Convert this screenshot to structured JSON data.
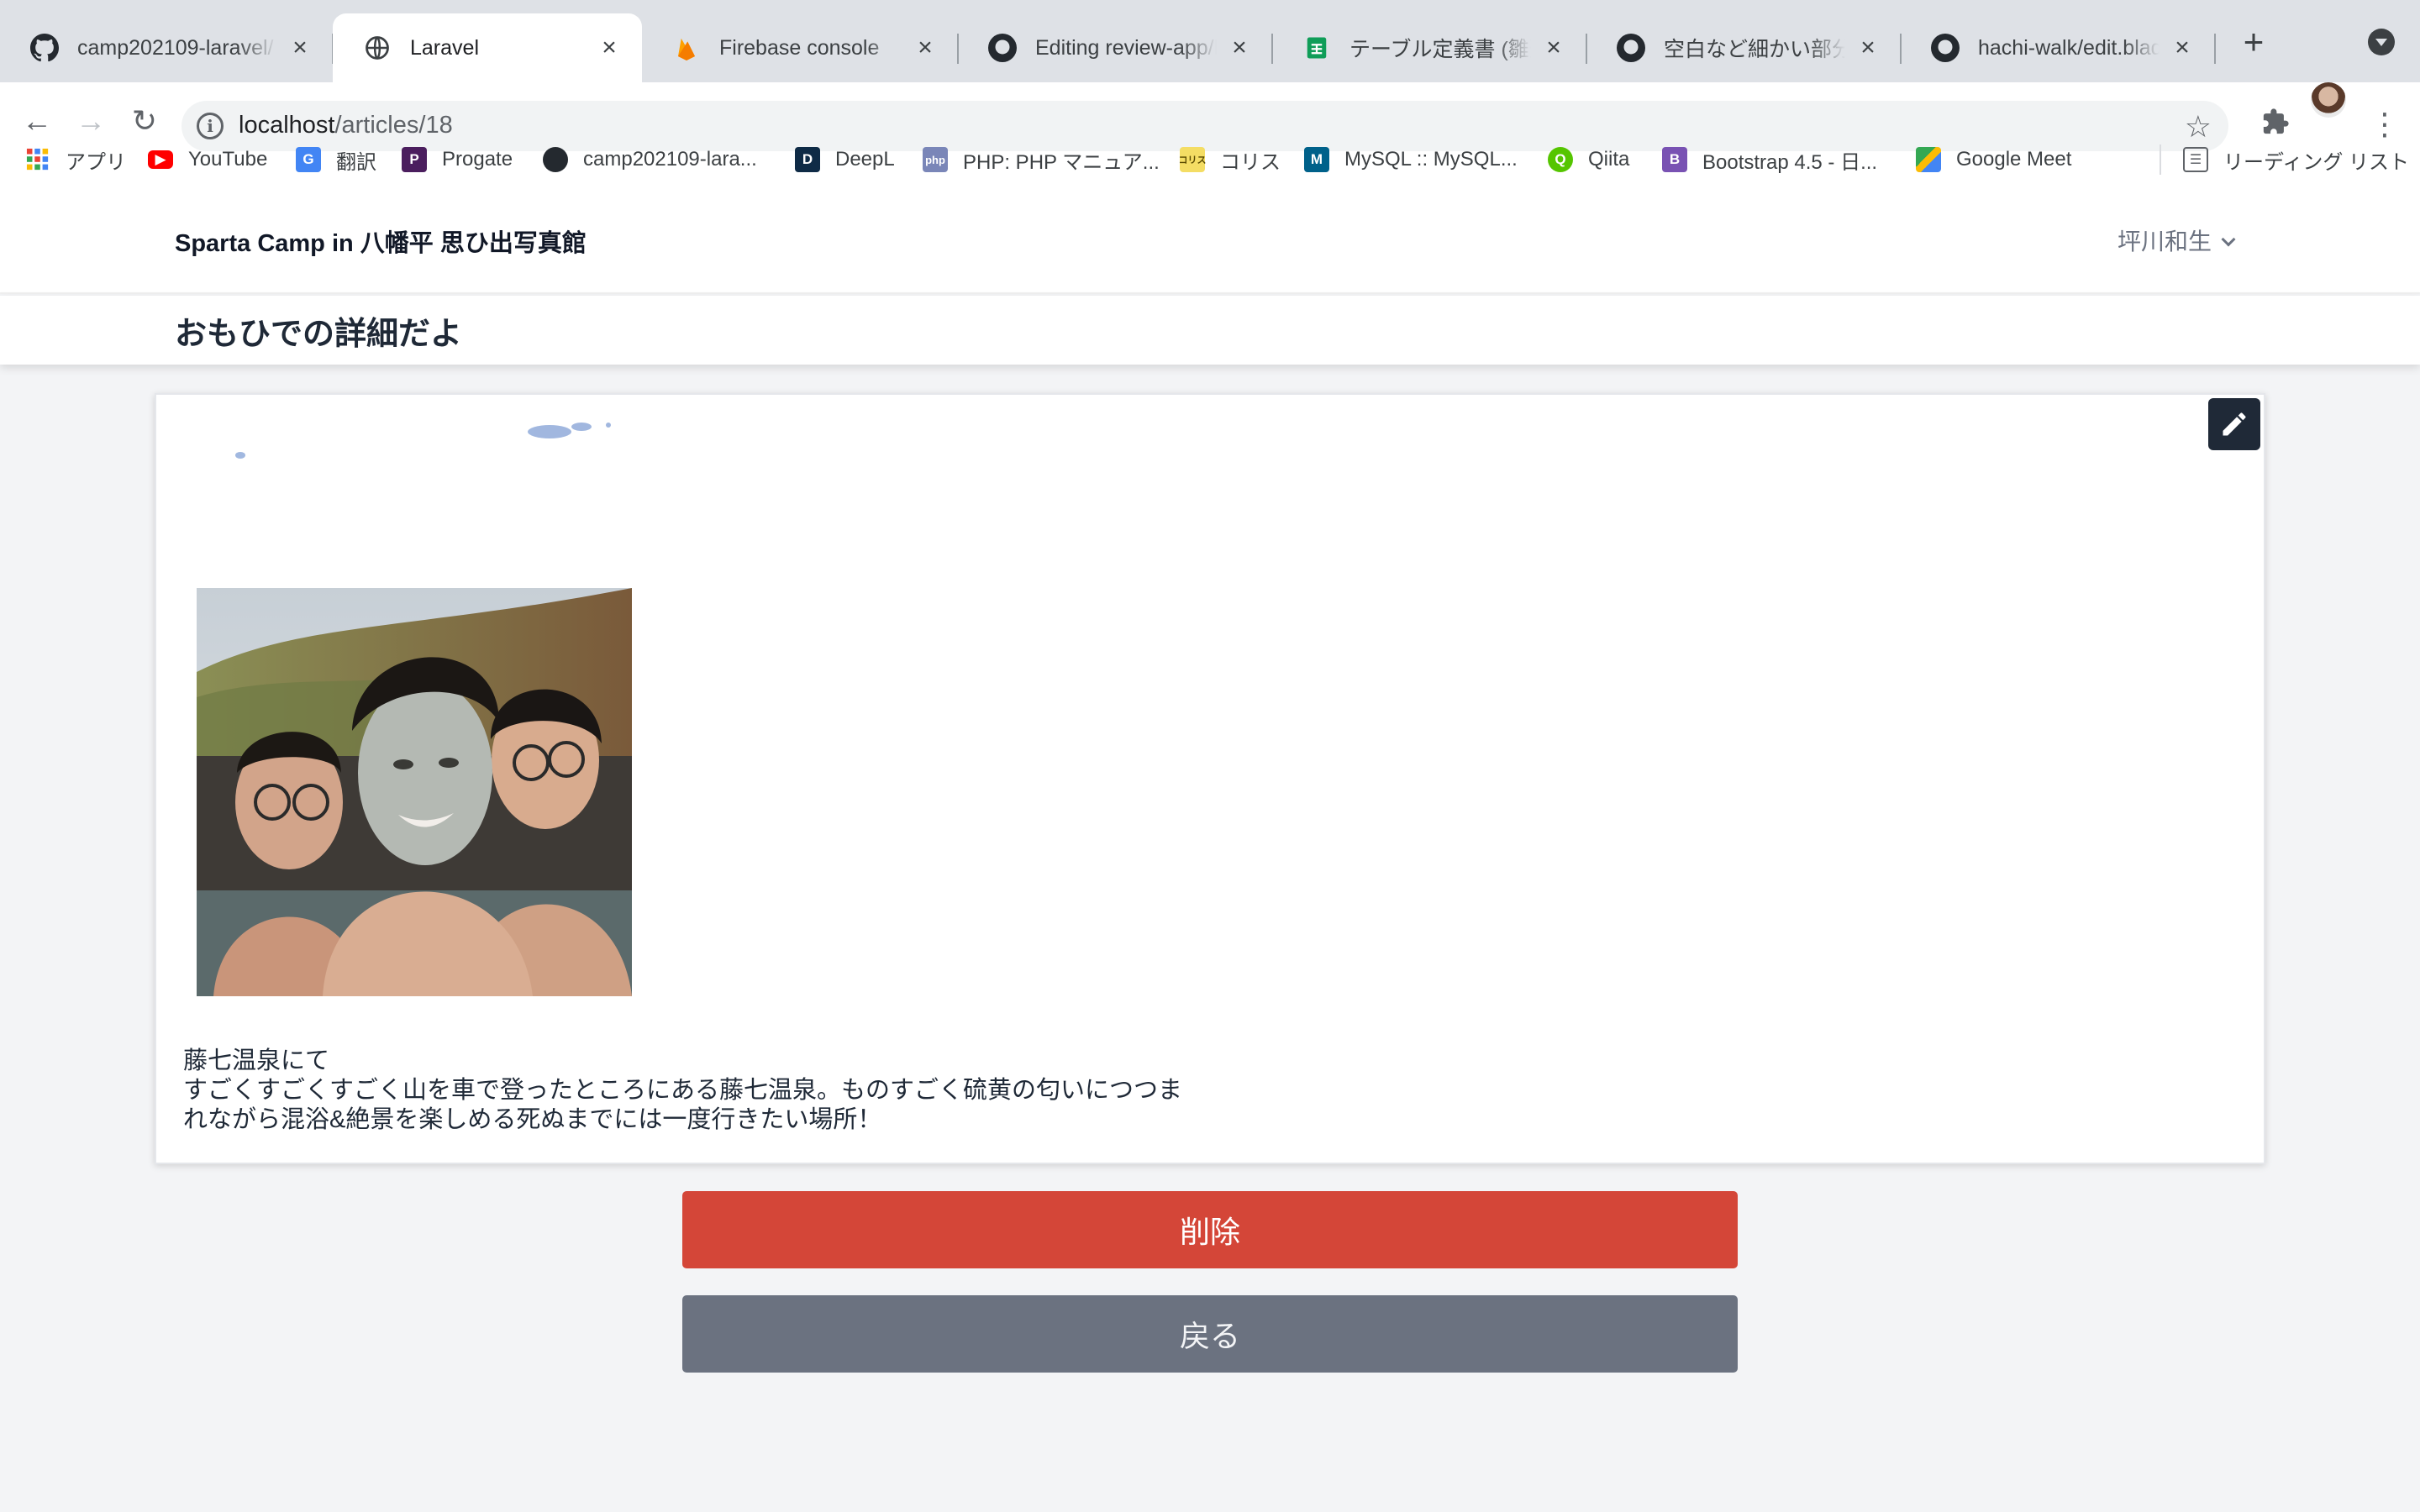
{
  "browser": {
    "tabs": [
      {
        "title": "camp202109-laravel/",
        "icon": "github-icon"
      },
      {
        "title": "Laravel",
        "icon": "globe-icon"
      },
      {
        "title": "Firebase console",
        "icon": "firebase-icon"
      },
      {
        "title": "Editing review-app/RE",
        "icon": "github-icon"
      },
      {
        "title": "テーブル定義書 (雛形) d",
        "icon": "sheets-icon"
      },
      {
        "title": "空白など細かい部分修正",
        "icon": "github-icon"
      },
      {
        "title": "hachi-walk/edit.blade",
        "icon": "github-icon"
      }
    ],
    "active_tab": 1,
    "address": {
      "host": "localhost",
      "path": "/articles/18"
    },
    "bookmarks": [
      {
        "label": "アプリ",
        "icon": "apps-grid-icon"
      },
      {
        "label": "YouTube",
        "icon": "youtube-icon"
      },
      {
        "label": "翻訳",
        "icon": "translate-icon"
      },
      {
        "label": "Progate",
        "icon": "progate-icon"
      },
      {
        "label": "camp202109-lara...",
        "icon": "github-icon"
      },
      {
        "label": "DeepL",
        "icon": "deepl-icon"
      },
      {
        "label": "PHP: PHP マニュア...",
        "icon": "php-icon"
      },
      {
        "label": "コリス",
        "icon": "coliss-icon"
      },
      {
        "label": "MySQL :: MySQL...",
        "icon": "mysql-icon"
      },
      {
        "label": "Qiita",
        "icon": "qiita-icon"
      },
      {
        "label": "Bootstrap 4.5 - 日...",
        "icon": "bootstrap-icon"
      },
      {
        "label": "Google Meet",
        "icon": "meet-icon"
      }
    ],
    "reading_list": "リーディング リスト"
  },
  "site": {
    "brand": "Sparta Camp in 八幡平 思ひ出写真館",
    "user": "坪川和生",
    "page_title": "おもひでの詳細だよ"
  },
  "article": {
    "caption_lines": [
      "藤七温泉にて",
      "すごくすごくすごく山を車で登ったところにある藤七温泉。ものすごく硫黄の匂いにつつま",
      "れながら混浴&絶景を楽しめる死ぬまでには一度行きたい場所！"
    ]
  },
  "actions": {
    "delete_label": "削除",
    "back_label": "戻る"
  },
  "colors": {
    "delete": "#d44638",
    "back": "#6b7280",
    "edit": "#1f2937"
  }
}
